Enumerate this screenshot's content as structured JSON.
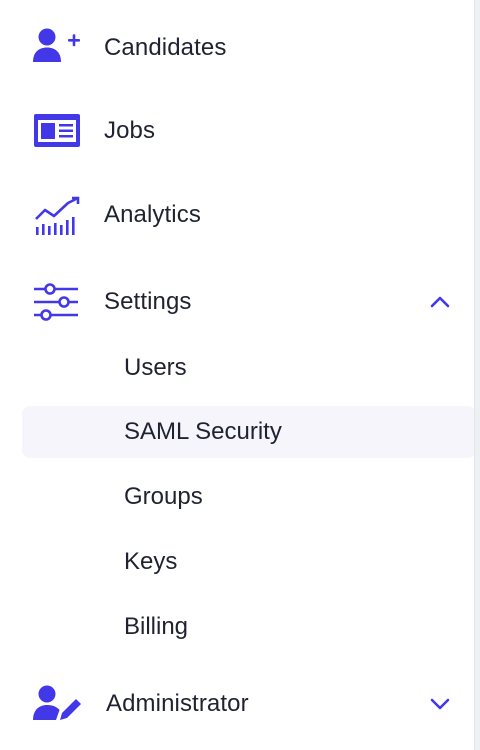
{
  "accent_color": "#4338e8",
  "nav": {
    "candidates": {
      "label": "Candidates",
      "icon": "user-plus-icon"
    },
    "jobs": {
      "label": "Jobs",
      "icon": "id-card-icon"
    },
    "analytics": {
      "label": "Analytics",
      "icon": "chart-icon"
    },
    "settings": {
      "label": "Settings",
      "icon": "sliders-icon",
      "expanded": true,
      "subitems": [
        {
          "label": "Users"
        },
        {
          "label": "SAML Security",
          "active": true
        },
        {
          "label": "Groups"
        },
        {
          "label": "Keys"
        },
        {
          "label": "Billing"
        }
      ]
    },
    "administrator": {
      "label": "Administrator",
      "icon": "user-edit-icon",
      "expanded": false
    }
  }
}
